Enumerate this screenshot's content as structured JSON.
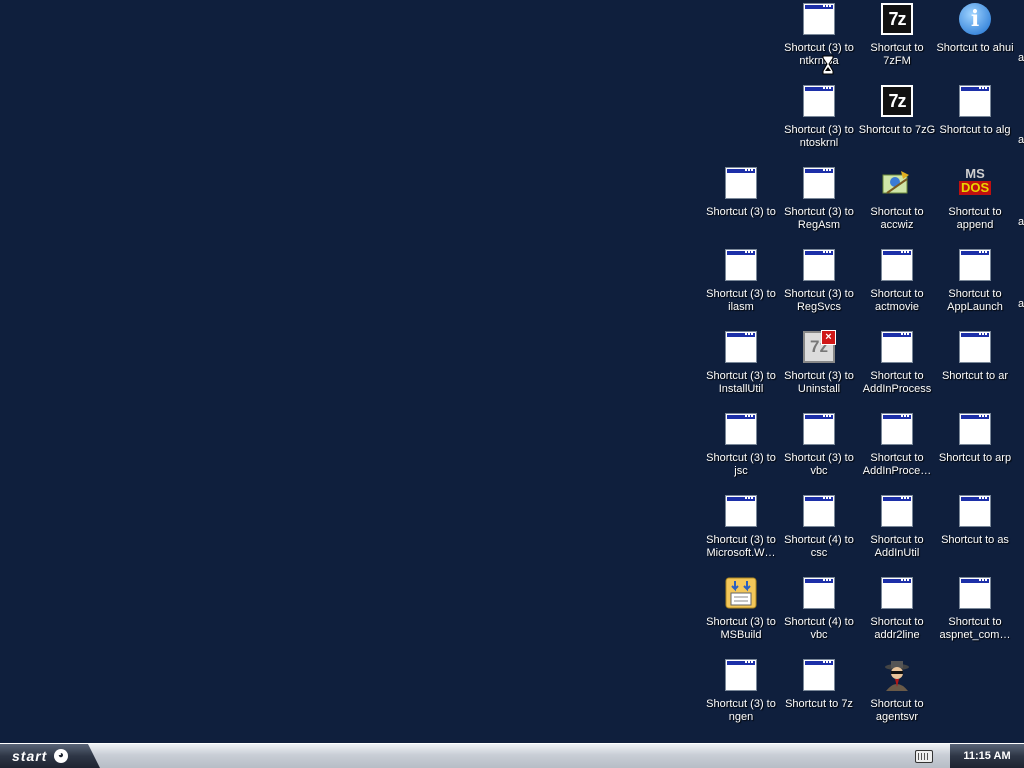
{
  "desktop": {
    "icons": [
      {
        "label": "Shortcut (3) to ntkrnlpa",
        "icon": "window-icon"
      },
      {
        "label": "Shortcut to 7zFM",
        "icon": "7z-icon"
      },
      {
        "label": "Shortcut to ahui",
        "icon": "info-icon"
      },
      {
        "label": "Shortcut (3) to ntoskrnl",
        "icon": "window-icon"
      },
      {
        "label": "Shortcut to 7zG",
        "icon": "7z-icon"
      },
      {
        "label": "Shortcut to alg",
        "icon": "window-icon"
      },
      {
        "label": "Shortcut (3) to",
        "icon": "window-icon"
      },
      {
        "label": "Shortcut (3) to RegAsm",
        "icon": "window-icon"
      },
      {
        "label": "Shortcut to accwiz",
        "icon": "accessibility-wizard-icon"
      },
      {
        "label": "Shortcut to append",
        "icon": "ms-dos-icon"
      },
      {
        "label": "Shortcut (3) to ilasm",
        "icon": "window-icon"
      },
      {
        "label": "Shortcut (3) to RegSvcs",
        "icon": "window-icon"
      },
      {
        "label": "Shortcut to actmovie",
        "icon": "window-icon"
      },
      {
        "label": "Shortcut to AppLaunch",
        "icon": "window-icon"
      },
      {
        "label": "Shortcut (3) to InstallUtil",
        "icon": "window-icon"
      },
      {
        "label": "Shortcut (3) to Uninstall",
        "icon": "7z-uninstall-icon"
      },
      {
        "label": "Shortcut to AddInProcess",
        "icon": "window-icon"
      },
      {
        "label": "Shortcut to ar",
        "icon": "window-icon"
      },
      {
        "label": "Shortcut (3) to jsc",
        "icon": "window-icon"
      },
      {
        "label": "Shortcut (3) to vbc",
        "icon": "window-icon"
      },
      {
        "label": "Shortcut to AddInProce…",
        "icon": "window-icon"
      },
      {
        "label": "Shortcut to arp",
        "icon": "window-icon"
      },
      {
        "label": "Shortcut (3) to Microsoft.W…",
        "icon": "window-icon"
      },
      {
        "label": "Shortcut (4) to csc",
        "icon": "window-icon"
      },
      {
        "label": "Shortcut to AddInUtil",
        "icon": "window-icon"
      },
      {
        "label": "Shortcut to as",
        "icon": "window-icon"
      },
      {
        "label": "Shortcut (3) to MSBuild",
        "icon": "msbuild-icon"
      },
      {
        "label": "Shortcut (4) to vbc",
        "icon": "window-icon"
      },
      {
        "label": "Shortcut to addr2line",
        "icon": "window-icon"
      },
      {
        "label": "Shortcut to aspnet_com…",
        "icon": "window-icon"
      },
      {
        "label": "Shortcut (3) to ngen",
        "icon": "window-icon"
      },
      {
        "label": "Shortcut to 7z",
        "icon": "window-icon"
      },
      {
        "label": "Shortcut to agentsvr",
        "icon": "agent-icon"
      }
    ],
    "edge_fragments": [
      "a",
      "a",
      "a",
      "a"
    ]
  },
  "taskbar": {
    "start_label": "start",
    "clock": "11:15 AM"
  }
}
